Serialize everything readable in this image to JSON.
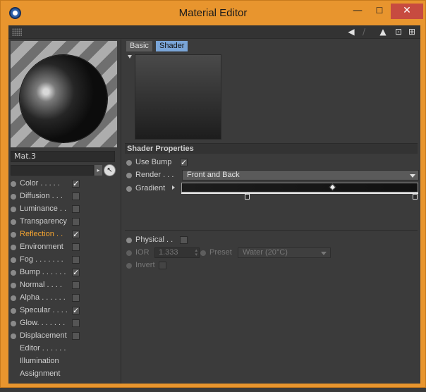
{
  "window": {
    "title": "Material Editor"
  },
  "titlebar_buttons": {
    "minimize": "—",
    "maximize": "☐",
    "close": "✕"
  },
  "material": {
    "name": "Mat.3"
  },
  "tabs": [
    {
      "label": "Basic",
      "active": false
    },
    {
      "label": "Shader",
      "active": true
    }
  ],
  "channels": [
    {
      "label": "Color . . . . .",
      "checked": true
    },
    {
      "label": "Diffusion . . .",
      "checked": false
    },
    {
      "label": "Luminance . .",
      "checked": false
    },
    {
      "label": "Transparency",
      "checked": false
    },
    {
      "label": "Reflection . .",
      "checked": true,
      "active": true
    },
    {
      "label": "Environment",
      "checked": false
    },
    {
      "label": "Fog . . . . . . .",
      "checked": false
    },
    {
      "label": "Bump . . . . . .",
      "checked": true
    },
    {
      "label": "Normal . . . .",
      "checked": false
    },
    {
      "label": "Alpha . . . . . .",
      "checked": false
    },
    {
      "label": "Specular . . . .",
      "checked": true
    },
    {
      "label": "Glow. . . . . . .",
      "checked": false
    },
    {
      "label": "Displacement",
      "checked": false
    }
  ],
  "extra_items": [
    "Editor . . . . . .",
    "Illumination",
    "Assignment"
  ],
  "shader": {
    "section_title": "Shader Properties",
    "use_bump_label": "Use Bump",
    "use_bump_checked": true,
    "render_label": "Render . . .",
    "render_value": "Front and Back",
    "gradient_label": "Gradient",
    "physical_label": "Physical . .",
    "physical_checked": false,
    "ior_label": "IOR",
    "ior_value": "1.333",
    "preset_label": "Preset",
    "preset_value": "Water (20°C)",
    "invert_label": "Invert",
    "invert_checked": false
  },
  "colors": {
    "title_bar": "#e8952e",
    "active_channel": "#f4a431",
    "active_tab": "#7aa5d8"
  }
}
